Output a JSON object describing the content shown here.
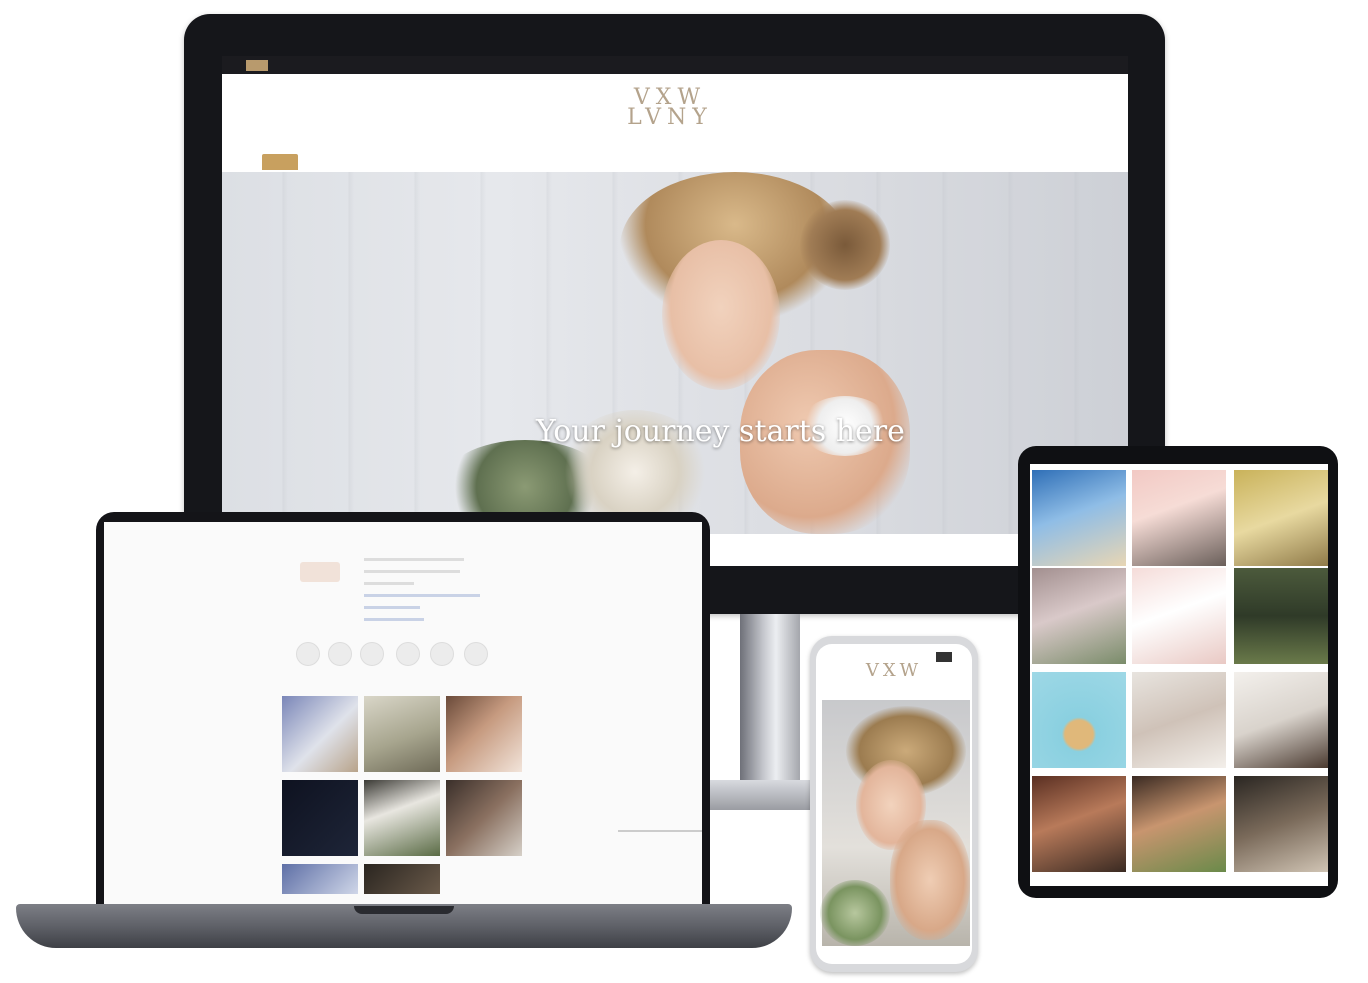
{
  "desktop": {
    "topbar_tagline": "",
    "topbar_links": [
      "",
      ""
    ],
    "logo_text": "VXW\nLVNY",
    "nav_items": [
      "",
      "",
      "",
      "",
      "",
      "",
      ""
    ],
    "hero_heading": "Your journey starts here",
    "hero_tabs": [
      "",
      ""
    ]
  },
  "laptop": {
    "page_label": "",
    "profile_lines": [
      "",
      "",
      "",
      ""
    ],
    "highlights": [
      "",
      "",
      "",
      "",
      "",
      ""
    ]
  },
  "phone": {
    "logo_text": "VXW",
    "hero_text": ""
  },
  "colors": {
    "accent_gold": "#c8a05f",
    "logo_taupe": "#b4a38c",
    "device_black": "#15161a"
  },
  "icons": {
    "phone_menu": "hamburger-icon"
  }
}
